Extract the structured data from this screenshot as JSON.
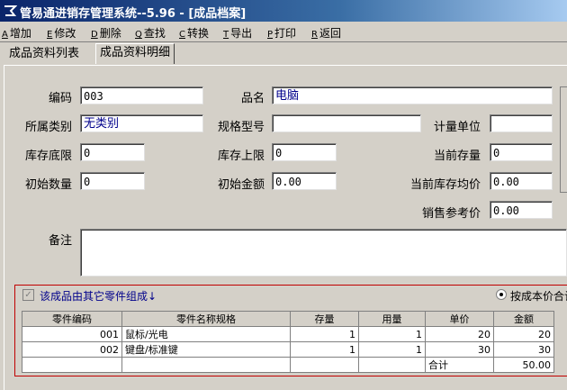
{
  "window": {
    "title": "管易通进销存管理系统--5.96 - [成品档案]"
  },
  "toolbar": [
    {
      "key": "A",
      "label": "增加"
    },
    {
      "key": "E",
      "label": "修改"
    },
    {
      "key": "D",
      "label": "删除"
    },
    {
      "key": "Q",
      "label": "查找"
    },
    {
      "key": "C",
      "label": "转换"
    },
    {
      "key": "T",
      "label": "导出"
    },
    {
      "key": "P",
      "label": "打印"
    },
    {
      "key": "R",
      "label": "返回"
    }
  ],
  "tabs": [
    {
      "label": "成品资料列表",
      "active": false
    },
    {
      "label": "成品资料明细",
      "active": true
    }
  ],
  "form": {
    "code": {
      "label": "编码",
      "value": "003"
    },
    "name": {
      "label": "品名",
      "value": "电脑"
    },
    "category": {
      "label": "所属类别",
      "value": "无类别"
    },
    "spec": {
      "label": "规格型号",
      "value": ""
    },
    "unit": {
      "label": "计量单位",
      "value": ""
    },
    "stock_min": {
      "label": "库存底限",
      "value": "0"
    },
    "stock_max": {
      "label": "库存上限",
      "value": "0"
    },
    "current_stock": {
      "label": "当前存量",
      "value": "0"
    },
    "init_qty": {
      "label": "初始数量",
      "value": "0"
    },
    "init_amount": {
      "label": "初始金额",
      "value": "0.00"
    },
    "avg_price": {
      "label": "当前库存均价",
      "value": "0.00"
    },
    "ref_price": {
      "label": "销售参考价",
      "value": "0.00"
    },
    "remark": {
      "label": "备注",
      "value": ""
    }
  },
  "components": {
    "checkbox_label": "该成品由其它零件组成↓",
    "checkbox_checked": true,
    "radio_label": "按成本价合计",
    "headers": [
      "零件编码",
      "零件名称规格",
      "存量",
      "用量",
      "单价",
      "金额"
    ],
    "rows": [
      [
        "001",
        "鼠标/光电",
        "1",
        "1",
        "20",
        "20"
      ],
      [
        "002",
        "键盘/标准键",
        "1",
        "1",
        "30",
        "30"
      ]
    ],
    "total_label": "合计",
    "total_value": "50.00"
  }
}
